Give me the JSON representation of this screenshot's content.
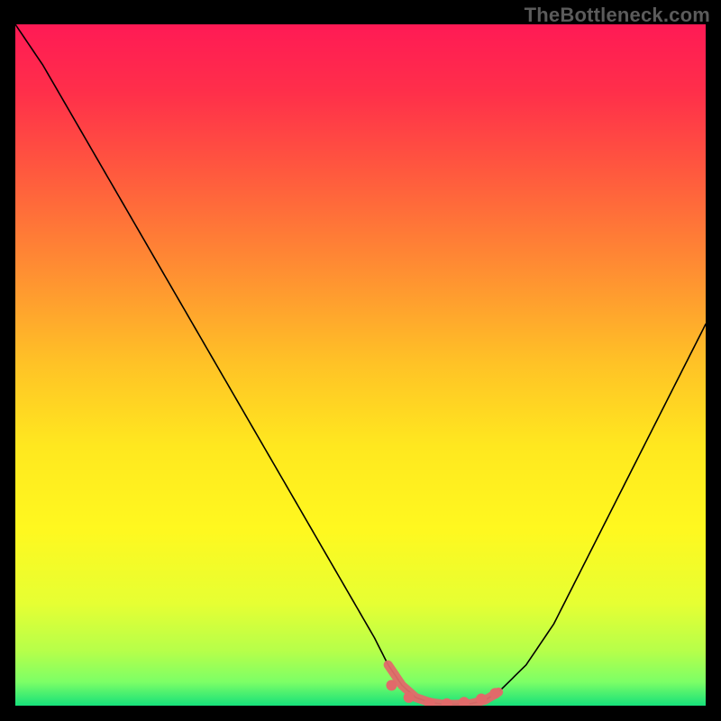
{
  "watermark": "TheBottleneck.com",
  "colors": {
    "curve": "#000000",
    "marker": "#e16a6a",
    "background": "#000000"
  },
  "gradient_stops": [
    {
      "offset": 0.0,
      "color": "#ff1a55"
    },
    {
      "offset": 0.1,
      "color": "#ff2f4a"
    },
    {
      "offset": 0.22,
      "color": "#ff5a3e"
    },
    {
      "offset": 0.35,
      "color": "#ff8a33"
    },
    {
      "offset": 0.5,
      "color": "#ffc326"
    },
    {
      "offset": 0.62,
      "color": "#ffe81f"
    },
    {
      "offset": 0.74,
      "color": "#fff81f"
    },
    {
      "offset": 0.85,
      "color": "#e6ff33"
    },
    {
      "offset": 0.92,
      "color": "#b6ff4a"
    },
    {
      "offset": 0.965,
      "color": "#7dff66"
    },
    {
      "offset": 1.0,
      "color": "#16e07a"
    }
  ],
  "chart_data": {
    "type": "line",
    "title": "",
    "xlabel": "",
    "ylabel": "",
    "xlim": [
      0,
      100
    ],
    "ylim": [
      0,
      100
    ],
    "x": [
      0,
      4,
      8,
      12,
      16,
      20,
      24,
      28,
      32,
      36,
      40,
      44,
      48,
      52,
      54,
      56,
      58,
      60,
      62,
      64,
      66,
      68,
      70,
      74,
      78,
      82,
      86,
      90,
      94,
      98,
      100
    ],
    "values": [
      100,
      94,
      87,
      80,
      73,
      66,
      59,
      52,
      45,
      38,
      31,
      24,
      17,
      10,
      6,
      3,
      1.2,
      0.5,
      0.2,
      0.2,
      0.3,
      0.8,
      2,
      6,
      12,
      20,
      28,
      36,
      44,
      52,
      56
    ],
    "flat_region_x": [
      54,
      70
    ],
    "markers": [
      {
        "x": 54.5,
        "y": 3.0
      },
      {
        "x": 57.0,
        "y": 1.2
      },
      {
        "x": 60.0,
        "y": 0.4
      },
      {
        "x": 62.5,
        "y": 0.3
      },
      {
        "x": 65.0,
        "y": 0.5
      },
      {
        "x": 67.5,
        "y": 1.0
      },
      {
        "x": 69.5,
        "y": 1.8
      }
    ]
  }
}
